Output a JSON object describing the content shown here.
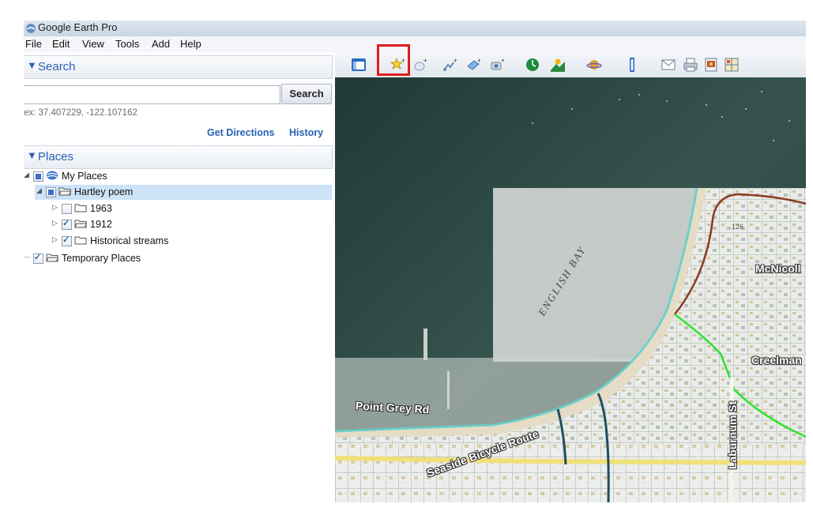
{
  "window": {
    "title": "Google Earth Pro",
    "icon": "google-earth-icon"
  },
  "menu": {
    "items": [
      "File",
      "Edit",
      "View",
      "Tools",
      "Add",
      "Help"
    ]
  },
  "search": {
    "header": "Search",
    "input_value": "",
    "button_label": "Search",
    "example_text": "ex: 37.407229, -122.107162",
    "get_directions": "Get Directions",
    "history": "History"
  },
  "places": {
    "header": "Places",
    "tree": [
      {
        "label": "My Places",
        "check": "partial",
        "icon": "globe-icon"
      },
      {
        "label": "Hartley poem",
        "check": "partial",
        "icon": "open-folder-icon",
        "selected": true
      },
      {
        "label": "1963",
        "check": "unchecked",
        "icon": "folder-icon"
      },
      {
        "label": "1912",
        "check": "checked",
        "icon": "open-folder-icon"
      },
      {
        "label": "Historical streams",
        "check": "checked",
        "icon": "folder-icon"
      },
      {
        "label": "Temporary Places",
        "check": "checked",
        "icon": "open-folder-icon"
      }
    ]
  },
  "toolbar": {
    "buttons": [
      "sidebar-toggle-icon",
      "add-placemark-icon",
      "add-polygon-icon",
      "add-path-icon",
      "add-image-overlay-icon",
      "record-tour-icon",
      "historical-imagery-icon",
      "sunlight-icon",
      "switch-planet-icon",
      "ruler-icon",
      "email-icon",
      "print-icon",
      "save-image-icon",
      "view-in-maps-icon"
    ],
    "highlighted": "add-placemark-icon",
    "highlight_color": "#e01c1c"
  },
  "map": {
    "labels": {
      "bay": "ENGLISH BAY",
      "street_1": "McNicoll",
      "street_2": "Creelman",
      "street_3": "Point Grey Rd",
      "street_4": "Seaside Bicycle Route",
      "street_5": "Laburnum St",
      "map_number": "126"
    },
    "colors": {
      "water": "#2f4a45",
      "overlay": "#e8ebe8",
      "green_path": "#2fe22f",
      "brown_path": "#8b3a22",
      "stream": "#1f4e63"
    }
  }
}
